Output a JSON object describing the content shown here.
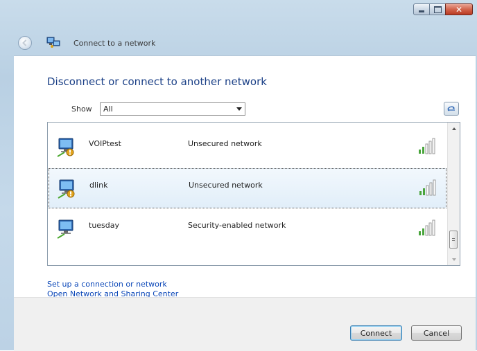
{
  "window": {
    "title": "Connect to a network",
    "caption": {
      "minimize": "minimize-icon",
      "maximize": "maximize-icon",
      "close_glyph": "✕"
    }
  },
  "main": {
    "headline": "Disconnect or connect to another network",
    "show_label": "Show",
    "show_value": "All"
  },
  "networks": [
    {
      "name": "VOIPtest",
      "security": "Unsecured network",
      "selected": false,
      "icon": "wireless-network-icon"
    },
    {
      "name": "dlink",
      "security": "Unsecured network",
      "selected": true,
      "icon": "wireless-network-icon"
    },
    {
      "name": "tuesday",
      "security": "Security-enabled network",
      "selected": false,
      "icon": "wireless-network-icon"
    }
  ],
  "links": {
    "setup": "Set up a connection or network",
    "sharing": "Open Network and Sharing Center"
  },
  "buttons": {
    "connect": "Connect",
    "cancel": "Cancel"
  },
  "colors": {
    "headline": "#1a3f86",
    "link": "#0b47b8",
    "selection": "#e1eef9"
  }
}
